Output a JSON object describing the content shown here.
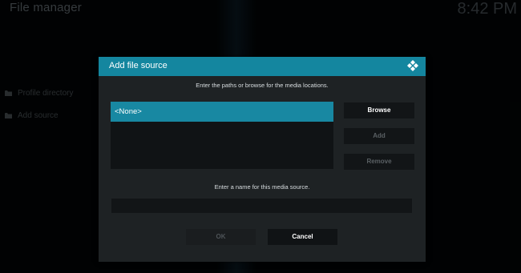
{
  "app": {
    "title": "File manager",
    "clock": "8:42 PM"
  },
  "sidebar": {
    "items": [
      {
        "label": "Profile directory",
        "icon": "folder-icon"
      },
      {
        "label": "Add source",
        "icon": "folder-icon"
      }
    ]
  },
  "dialog": {
    "title": "Add file source",
    "logo_icon": "kodi-logo-icon",
    "instruction_paths": "Enter the paths or browse for the media locations.",
    "paths": [
      "<None>"
    ],
    "selected_path_index": 0,
    "buttons": {
      "browse": "Browse",
      "add": "Add",
      "remove": "Remove"
    },
    "instruction_name": "Enter a name for this media source.",
    "name_value": "",
    "ok": "OK",
    "cancel": "Cancel"
  },
  "colors": {
    "accent": "#14869f",
    "selected_item": "#1888a2",
    "dialog_bg": "#1e2224",
    "background": "#020405"
  }
}
